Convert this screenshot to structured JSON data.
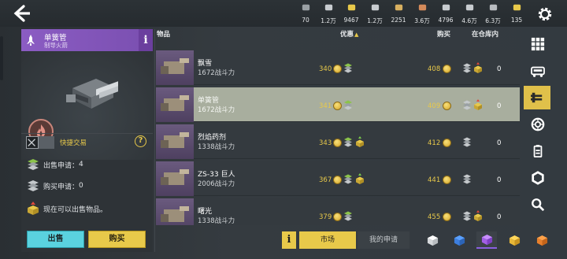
{
  "topbar": {
    "resources": [
      {
        "icon": "ammo-icon",
        "value": "70"
      },
      {
        "icon": "pen-icon",
        "value": "1.2万"
      },
      {
        "icon": "chip-icon",
        "value": "9467"
      },
      {
        "icon": "fuel-icon",
        "value": "1.2万"
      },
      {
        "icon": "canister-icon",
        "value": "2251"
      },
      {
        "icon": "plank-icon",
        "value": "3.6万"
      },
      {
        "icon": "gear-part-icon",
        "value": "4796"
      },
      {
        "icon": "ring-icon",
        "value": "4.6万"
      },
      {
        "icon": "coin-silver-icon",
        "value": "6.3万"
      },
      {
        "icon": "coin-gold-icon",
        "value": "135"
      }
    ]
  },
  "selected_item": {
    "name": "单簧管",
    "subtitle": "制导火箭",
    "quick_trade_label": "快捷交易",
    "sell_requests_label": "出售申请：",
    "sell_requests_value": "4",
    "buy_requests_label": "购买申请：",
    "buy_requests_value": "0",
    "sell_notice": "现在可以出售物品。",
    "sell_button": "出售",
    "buy_button": "购买"
  },
  "table": {
    "headers": {
      "item": "物品",
      "offer": "优惠",
      "offer_sort": "▲",
      "buy": "购买",
      "stock": "在仓库内"
    },
    "rows": [
      {
        "name": "飘雪",
        "power": "1672战斗力",
        "offer": "340",
        "buy": "408",
        "stock": "0",
        "selected": false
      },
      {
        "name": "单簧管",
        "power": "1672战斗力",
        "offer": "341",
        "buy": "409",
        "stock": "0",
        "selected": true
      },
      {
        "name": "烈焰药剂",
        "power": "1338战斗力",
        "offer": "343",
        "buy": "412",
        "stock": "0",
        "selected": false
      },
      {
        "name": "ZS-33 巨人",
        "power": "2006战斗力",
        "offer": "367",
        "buy": "441",
        "stock": "0",
        "selected": false
      },
      {
        "name": "曙光",
        "power": "1338战斗力",
        "offer": "379",
        "buy": "455",
        "stock": "0",
        "selected": false
      }
    ]
  },
  "bottom": {
    "info_tab": "i",
    "market_tab": "市场",
    "my_requests_tab": "我的申请"
  },
  "colors": {
    "accent": "#e8c94a",
    "purple": "#8b5cc3",
    "cyan": "#5ad2df"
  }
}
